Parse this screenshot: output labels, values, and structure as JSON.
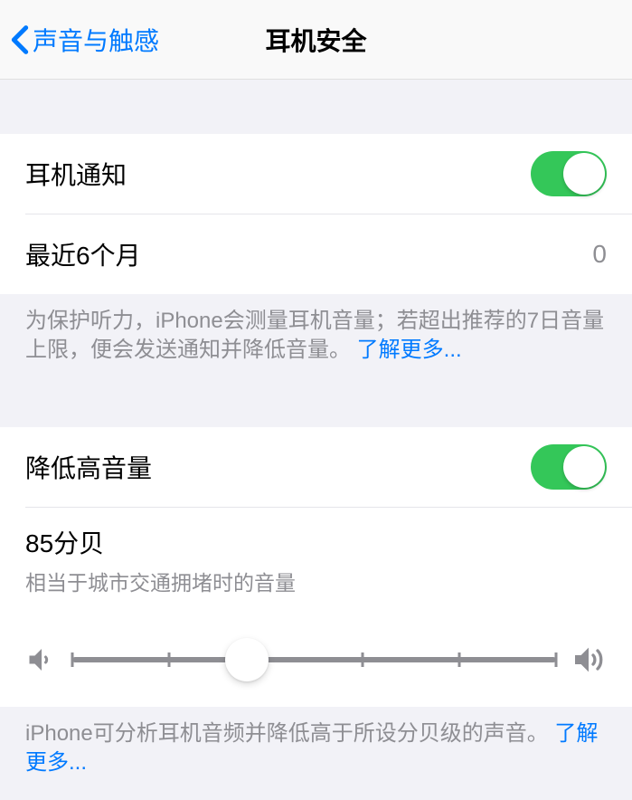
{
  "nav": {
    "back_label": "声音与触感",
    "title": "耳机安全"
  },
  "section1": {
    "headphone_notifications_label": "耳机通知",
    "headphone_notifications_on": true,
    "last_6_months_label": "最近6个月",
    "last_6_months_value": "0",
    "footer_text": "为保护听力，iPhone会测量耳机音量；若超出推荐的7日音量上限，便会发送通知并降低音量。",
    "footer_link": "了解更多..."
  },
  "section2": {
    "reduce_loud_label": "降低高音量",
    "reduce_loud_on": true,
    "decibel_value": "85分贝",
    "decibel_description": "相当于城市交通拥堵时的音量",
    "slider_fraction": 0.36,
    "footer_text": "iPhone可分析耳机音频并降低高于所设分贝级的声音。",
    "footer_link": "了解更多..."
  }
}
